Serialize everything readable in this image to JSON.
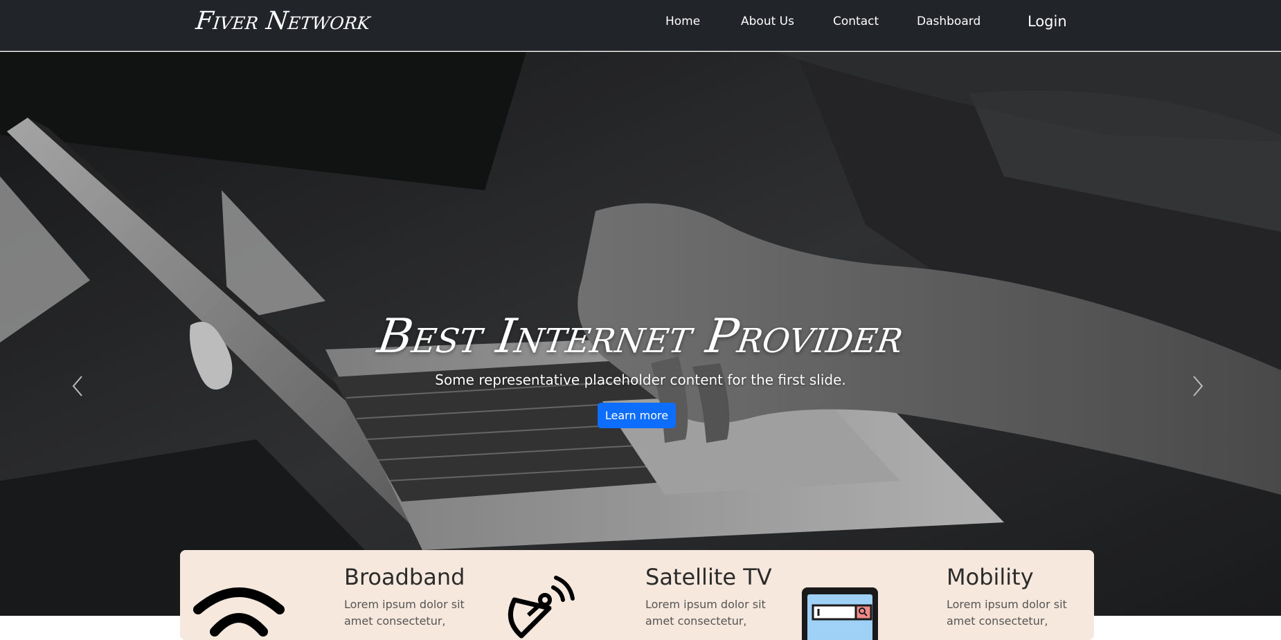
{
  "navbar": {
    "brand": "Fiver Network",
    "links": [
      {
        "label": "Home"
      },
      {
        "label": "About Us"
      },
      {
        "label": "Contact"
      },
      {
        "label": "Dashboard"
      }
    ],
    "login": "Login"
  },
  "hero": {
    "title": "Best Internet Provider",
    "subtitle": "Some representative placeholder content for the first slide.",
    "button_label": "Learn more",
    "prev_icon": "chevron-left-icon",
    "next_icon": "chevron-right-icon"
  },
  "services": [
    {
      "title": "Broadband",
      "text": "Lorem ipsum dolor sit amet consectetur,",
      "icon": "wifi-icon"
    },
    {
      "title": "Satellite TV",
      "text": "Lorem ipsum dolor sit amet consectetur,",
      "icon": "satellite-dish-icon"
    },
    {
      "title": "Mobility",
      "text": "Lorem ipsum dolor sit amet consectetur,",
      "icon": "browser-search-icon"
    }
  ],
  "colors": {
    "navbar_bg": "#212529",
    "primary_button": "#0d6efd",
    "services_bg": "#f6e8dc"
  }
}
